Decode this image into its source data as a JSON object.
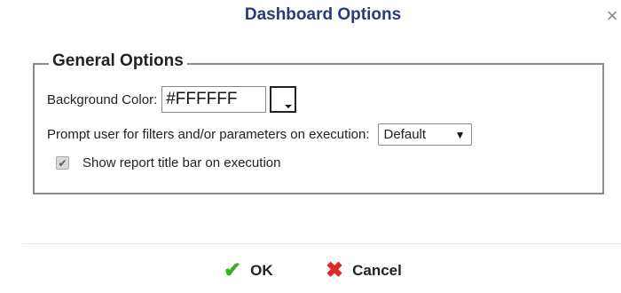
{
  "dialog": {
    "title": "Dashboard Options",
    "close_symbol": "×"
  },
  "general": {
    "legend": "General Options",
    "background_label": "Background Color:",
    "background_value": "#FFFFFF",
    "prompt_label": "Prompt user for filters and/or parameters on execution:",
    "prompt_selected": "Default",
    "show_title_label": "Show report title bar on execution",
    "show_title_checked": true
  },
  "buttons": {
    "ok_label": "OK",
    "cancel_label": "Cancel"
  },
  "icons": {
    "close": "close-icon",
    "dropdown": "chevron-down-icon",
    "ok": "checkmark-icon",
    "cancel": "x-icon"
  },
  "colors": {
    "title": "#2b3a78",
    "ok_icon": "#35b323",
    "cancel_icon": "#dd2a22"
  }
}
